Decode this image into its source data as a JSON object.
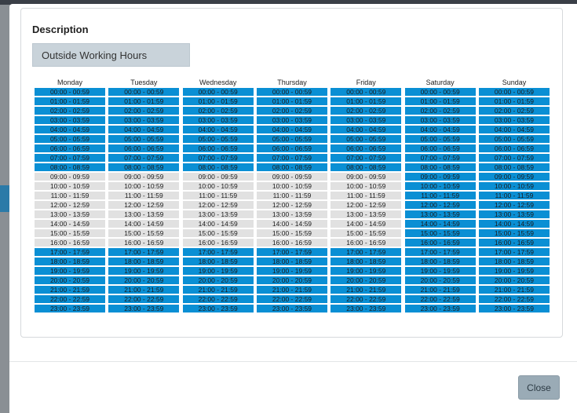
{
  "description": {
    "label": "Description",
    "value": "Outside Working Hours"
  },
  "days": [
    "Monday",
    "Tuesday",
    "Wednesday",
    "Thursday",
    "Friday",
    "Saturday",
    "Sunday"
  ],
  "slots": [
    "00:00 - 00:59",
    "01:00 - 01:59",
    "02:00 - 02:59",
    "03:00 - 03:59",
    "04:00 - 04:59",
    "05:00 - 05:59",
    "06:00 - 06:59",
    "07:00 - 07:59",
    "08:00 - 08:59",
    "09:00 - 09:59",
    "10:00 - 10:59",
    "11:00 - 11:59",
    "12:00 - 12:59",
    "13:00 - 13:59",
    "14:00 - 14:59",
    "15:00 - 15:59",
    "16:00 - 16:59",
    "17:00 - 17:59",
    "18:00 - 18:59",
    "19:00 - 19:59",
    "20:00 - 20:59",
    "21:00 - 21:59",
    "22:00 - 22:59",
    "23:00 - 23:59"
  ],
  "selected": {
    "Monday": [
      1,
      1,
      1,
      1,
      1,
      1,
      1,
      1,
      1,
      0,
      0,
      0,
      0,
      0,
      0,
      0,
      0,
      1,
      1,
      1,
      1,
      1,
      1,
      1
    ],
    "Tuesday": [
      1,
      1,
      1,
      1,
      1,
      1,
      1,
      1,
      1,
      0,
      0,
      0,
      0,
      0,
      0,
      0,
      0,
      1,
      1,
      1,
      1,
      1,
      1,
      1
    ],
    "Wednesday": [
      1,
      1,
      1,
      1,
      1,
      1,
      1,
      1,
      1,
      0,
      0,
      0,
      0,
      0,
      0,
      0,
      0,
      1,
      1,
      1,
      1,
      1,
      1,
      1
    ],
    "Thursday": [
      1,
      1,
      1,
      1,
      1,
      1,
      1,
      1,
      1,
      0,
      0,
      0,
      0,
      0,
      0,
      0,
      0,
      1,
      1,
      1,
      1,
      1,
      1,
      1
    ],
    "Friday": [
      1,
      1,
      1,
      1,
      1,
      1,
      1,
      1,
      1,
      0,
      0,
      0,
      0,
      0,
      0,
      0,
      0,
      1,
      1,
      1,
      1,
      1,
      1,
      1
    ],
    "Saturday": [
      1,
      1,
      1,
      1,
      1,
      1,
      1,
      1,
      1,
      1,
      1,
      1,
      1,
      1,
      1,
      1,
      1,
      1,
      1,
      1,
      1,
      1,
      1,
      1
    ],
    "Sunday": [
      1,
      1,
      1,
      1,
      1,
      1,
      1,
      1,
      1,
      1,
      1,
      1,
      1,
      1,
      1,
      1,
      1,
      1,
      1,
      1,
      1,
      1,
      1,
      1
    ]
  },
  "colors": {
    "selected": "#0a8fd4",
    "unselected": "#e1e1e1"
  },
  "footer": {
    "close_label": "Close"
  }
}
